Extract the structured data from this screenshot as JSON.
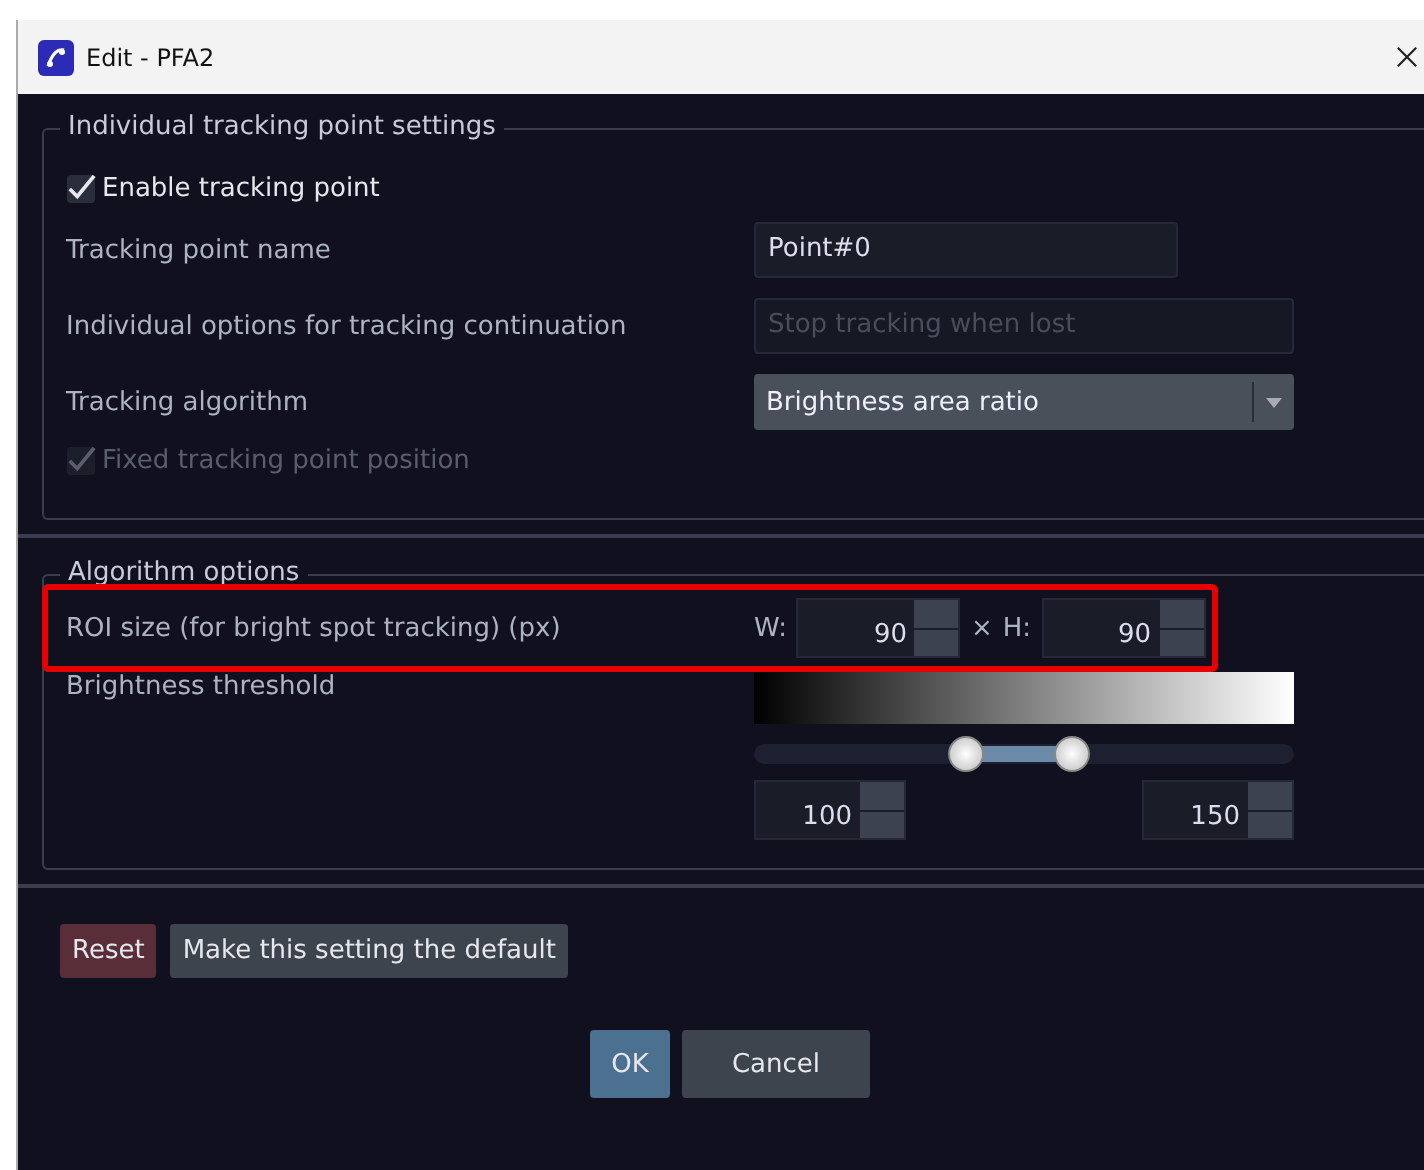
{
  "window": {
    "title": "Edit - PFA2"
  },
  "tracking_settings": {
    "title": "Individual tracking point settings",
    "enable": {
      "label": "Enable tracking point",
      "checked": true,
      "disabled": false
    },
    "rows": [
      {
        "kind": "text",
        "label": "Tracking point name",
        "value": "Point#0",
        "disabled": false
      },
      {
        "kind": "text",
        "label": "Individual options for tracking continuation",
        "value": "Stop tracking when lost",
        "disabled": true
      },
      {
        "kind": "dropdown",
        "label": "Tracking algorithm",
        "value": "Brightness area ratio",
        "disabled": false
      }
    ],
    "fixed": {
      "label": "Fixed tracking point position",
      "checked": true,
      "disabled": true
    }
  },
  "algorithm_options": {
    "title": "Algorithm options",
    "roi": {
      "label": "ROI size (for bright spot tracking) (px)",
      "w_label": "W:",
      "w_value": "90",
      "times": "×",
      "h_label": "H:",
      "h_value": "90",
      "highlighted": true
    },
    "threshold": {
      "label": "Brightness threshold",
      "thumbs": [
        {
          "level": 0.392
        },
        {
          "level": 0.588
        }
      ],
      "low_value": "100",
      "high_value": "150"
    }
  },
  "buttons": [
    {
      "label": "Reset",
      "kind": "danger"
    },
    {
      "label": "Make this setting the default",
      "kind": "normal"
    }
  ],
  "dialog_buttons": [
    {
      "label": "OK",
      "kind": "primary"
    },
    {
      "label": "Cancel",
      "kind": "normal"
    }
  ]
}
